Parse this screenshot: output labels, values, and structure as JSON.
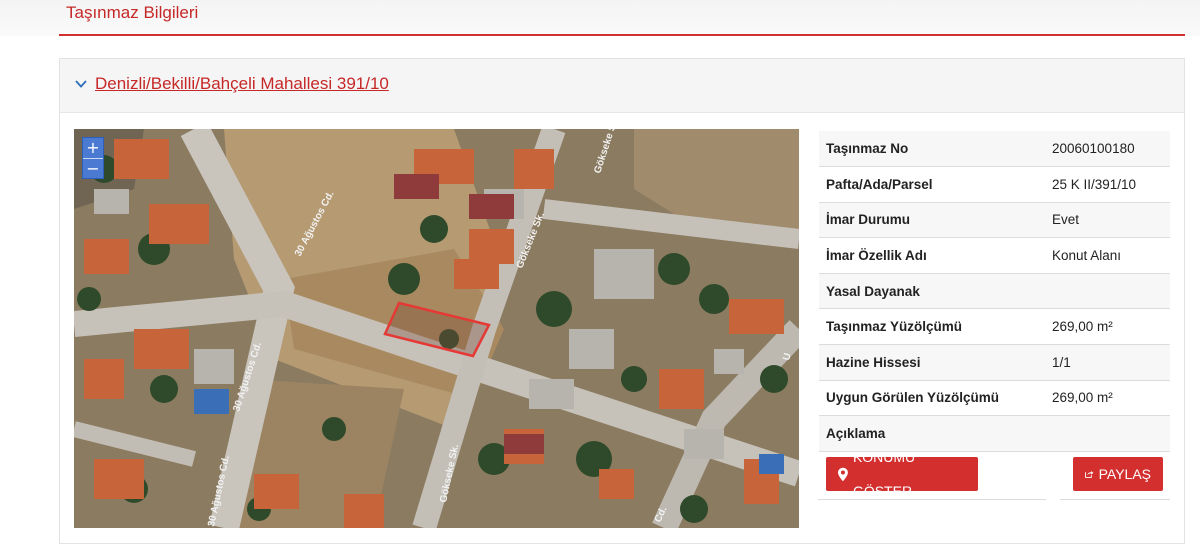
{
  "section": {
    "title": "Taşınmaz Bilgileri"
  },
  "card": {
    "title": "Denizli/Bekilli/Bahçeli Mahallesi 391/10",
    "chevron_icon": "chevron-down-icon"
  },
  "map": {
    "zoom_in": "+",
    "zoom_out": "−",
    "street_labels": {
      "agustos_top": "30 Ağustos Cd.",
      "agustos_mid": "30 Ağustos Cd.",
      "agustos_bottom": "30 Ağustos Cd.",
      "gokseke_top": "Gökseke Sk.",
      "gokseke_mid": "Gökseke Sk.",
      "gokseke_bottom": "Gökseke Sk.",
      "cd_bottom": "Cd.",
      "u_edge": "U"
    },
    "parcel_color": "#e53935"
  },
  "info": {
    "rows": [
      {
        "key": "Taşınmaz No",
        "value": "20060100180"
      },
      {
        "key": "Pafta/Ada/Parsel",
        "value": "25 K II/391/10"
      },
      {
        "key": "İmar Durumu",
        "value": "Evet"
      },
      {
        "key": "İmar Özellik Adı",
        "value": "Konut Alanı"
      },
      {
        "key": "Yasal Dayanak",
        "value": ""
      },
      {
        "key": "Taşınmaz Yüzölçümü",
        "value": "269,00 m²"
      },
      {
        "key": "Hazine Hissesi",
        "value": "1/1"
      },
      {
        "key": "Uygun Görülen Yüzölçümü",
        "value": "269,00 m²"
      },
      {
        "key": "Açıklama",
        "value": ""
      }
    ]
  },
  "buttons": {
    "konum": {
      "label": "KONUMU GÖSTER",
      "icon": "map-marker-icon"
    },
    "paylas": {
      "label": "PAYLAŞ",
      "icon": "share-icon"
    }
  },
  "colors": {
    "accent": "#d32f2f",
    "title_red": "#c62828",
    "zoom_blue": "#4a7ad1"
  }
}
